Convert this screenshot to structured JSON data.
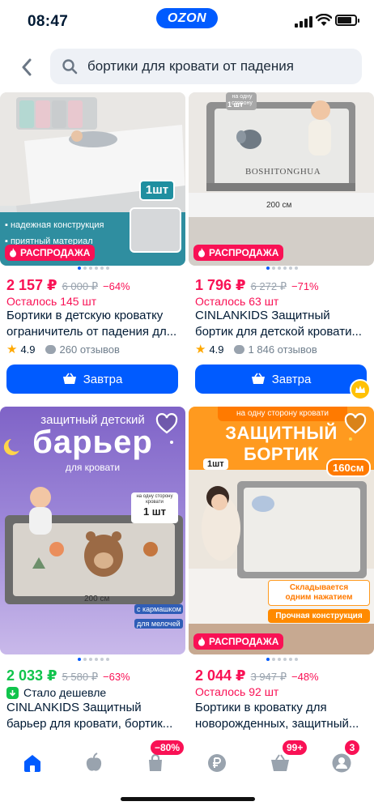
{
  "status_bar": {
    "time": "08:47",
    "logo": "OZON"
  },
  "search": {
    "query": "бортики для кровати от падения",
    "icon": "search-icon",
    "back_icon": "chevron-left-icon"
  },
  "colors": {
    "accent": "#005bff",
    "sale": "#f91155",
    "green": "#10c44c",
    "star": "#ffa800"
  },
  "products": [
    {
      "image_text": {
        "qty": "1шт",
        "bullet1": "надежная конструкция",
        "bullet2": "приятный материал"
      },
      "badge": "РАСПРОДАЖА",
      "price": "2 157 ₽",
      "old_price": "6 000 ₽",
      "discount": "−64%",
      "stock": "Осталось 145 шт",
      "title_line1": "Бортики в детскую кроватку",
      "title_line2": "ограничитель от падения дл...",
      "rating": "4.9",
      "reviews": "260 отзывов",
      "button": "Завтра"
    },
    {
      "image_text": {
        "top": "на одну сторону",
        "qty": "1 шт",
        "brand": "BOSHITONGHUA",
        "size": "200 см"
      },
      "badge": "РАСПРОДАЖА",
      "price": "1 796 ₽",
      "old_price": "6 272 ₽",
      "discount": "−71%",
      "stock": "Осталось 63 шт",
      "title_line1": "CINLANKIDS Защитный",
      "title_line2": "бортик для детской кровати...",
      "rating": "4.9",
      "reviews": "1 846 отзывов",
      "button": "Завтра"
    },
    {
      "image_text": {
        "line1": "защитный детский",
        "line2": "барьер",
        "line3": "для кровати",
        "side": "на одну сторону кровати",
        "qty": "1 шт",
        "size": "200 см",
        "pocket1": "с кармашком",
        "pocket2": "для мелочей"
      },
      "price": "2 033 ₽",
      "old_price": "5 580 ₽",
      "discount": "−63%",
      "cheaper": "Стало дешевле",
      "title_line1": "CINLANKIDS Защитный",
      "title_line2": "барьер для кровати, бортик..."
    },
    {
      "image_text": {
        "top": "на одну сторону кровати",
        "line1": "ЗАЩИТНЫЙ",
        "line2": "БОРТИК",
        "qty": "1шт",
        "size": "160см",
        "feature1a": "Складывается",
        "feature1b": "одним нажатием",
        "feature2": "Прочная конструкция"
      },
      "badge": "РАСПРОДАЖА",
      "price": "2 044 ₽",
      "old_price": "3 947 ₽",
      "discount": "−48%",
      "stock": "Осталось 92 шт",
      "title_line1": "Бортики в кроватку для",
      "title_line2": "новорожденных, защитный..."
    }
  ],
  "tabbar": {
    "items": [
      "home-icon",
      "fresh-icon",
      "discount-bag-icon",
      "ruble-icon",
      "cart-icon",
      "profile-icon"
    ],
    "badge_discount": "−80%",
    "badge_cart": "99+",
    "badge_profile": "3"
  }
}
